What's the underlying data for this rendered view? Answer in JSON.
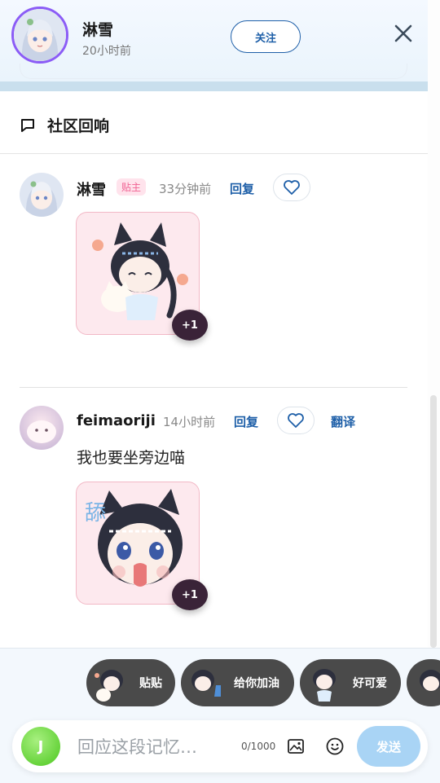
{
  "header": {
    "name": "淋雪",
    "time": "20小时前",
    "follow_label": "关注"
  },
  "section": {
    "title": "社区回响"
  },
  "comments": [
    {
      "name": "淋雪",
      "badge": "贴主",
      "time": "33分钟前",
      "reply_label": "回复",
      "sticker_badge": "+1"
    },
    {
      "name": "feimaoriji",
      "time": "14小时前",
      "reply_label": "回复",
      "translate_label": "翻译",
      "text": "我也要坐旁边喵",
      "sticker_badge": "+1"
    }
  ],
  "quick_replies": [
    "贴贴",
    "给你加油",
    "好可爱"
  ],
  "composer": {
    "avatar_letter": "J",
    "placeholder": "回应这段记忆…",
    "char_count": "0/1000",
    "send_label": "发送"
  },
  "icons": {
    "close": "close-icon",
    "comment": "comment-icon",
    "heart": "heart-icon",
    "image": "image-icon",
    "emoji": "emoji-icon"
  },
  "colors": {
    "accent": "#1e5fa8",
    "badge_bg": "#ffe3ec",
    "badge_text": "#f06292",
    "send_bg": "#a9d4f5",
    "avatar_ring": "#8b5cf6"
  }
}
